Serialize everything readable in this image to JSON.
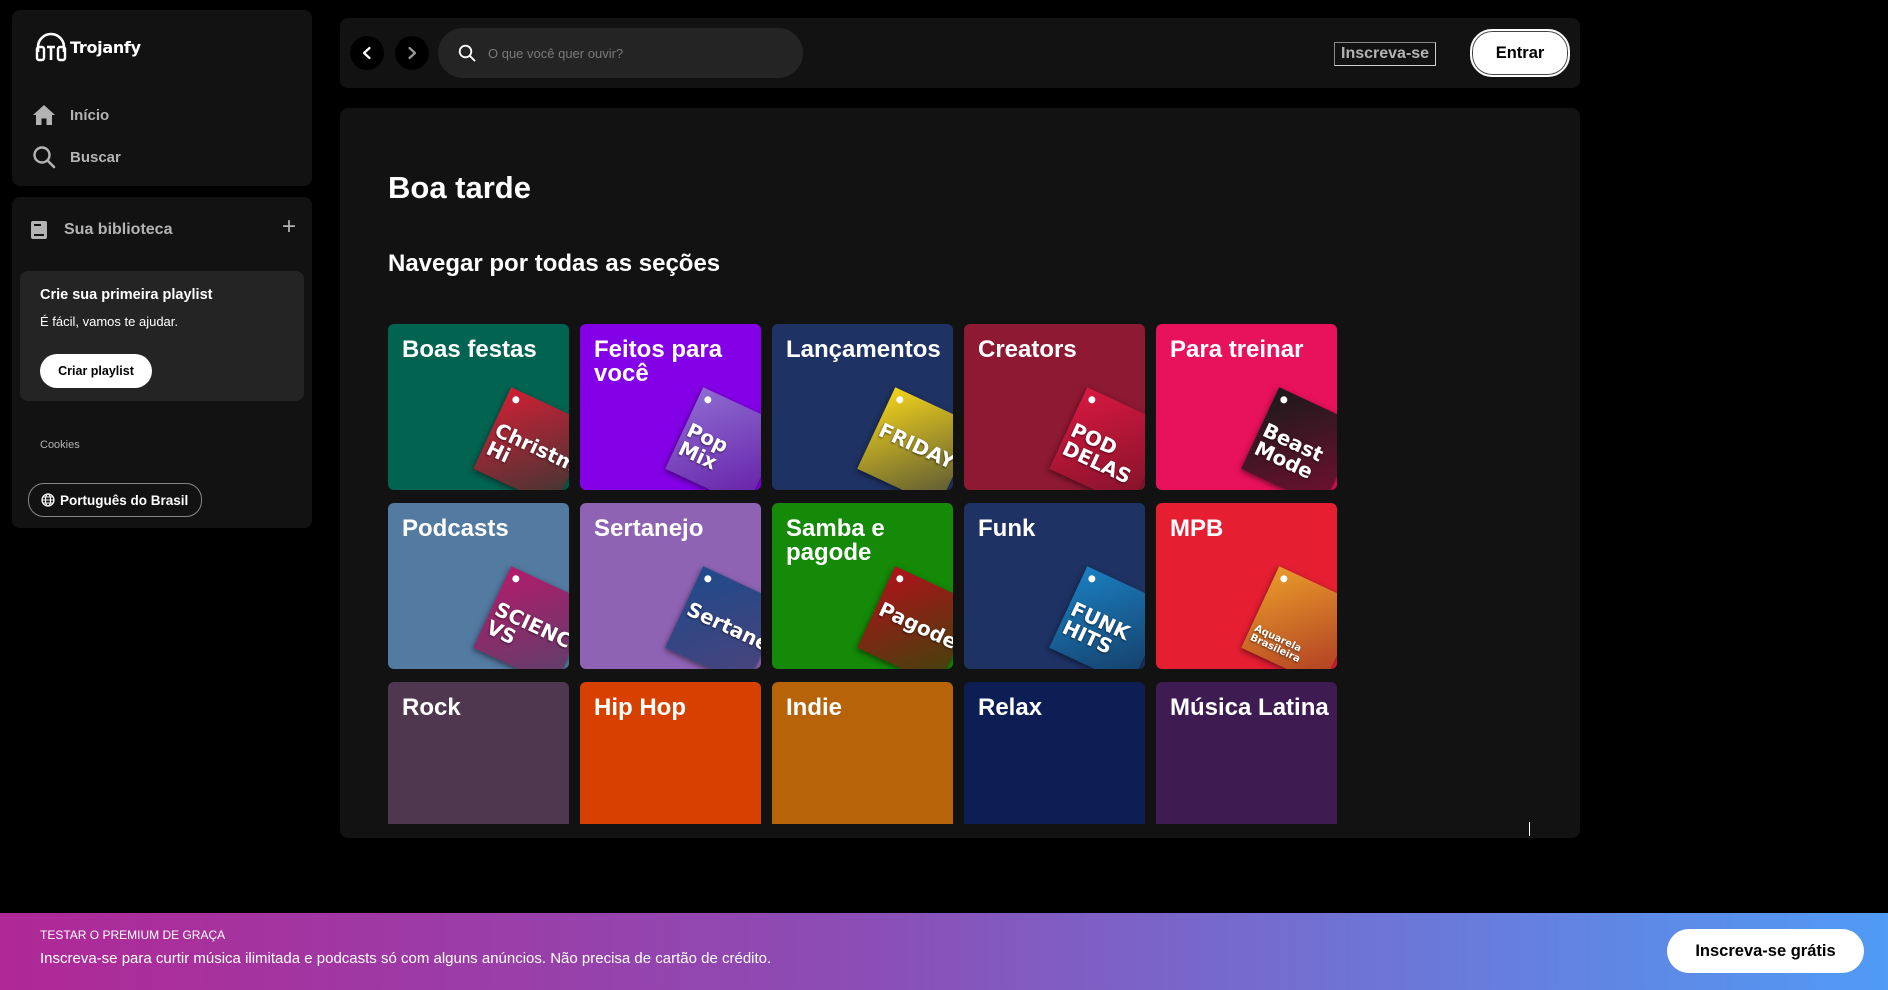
{
  "brand": {
    "name": "Trojanfy"
  },
  "nav": {
    "home": "Início",
    "search": "Buscar"
  },
  "library": {
    "title": "Sua biblioteca",
    "add_symbol": "+",
    "create_card": {
      "title": "Crie sua primeira playlist",
      "subtitle": "É fácil, vamos te ajudar.",
      "button": "Criar playlist"
    },
    "cookies": "Cookies",
    "language": "Português do Brasil"
  },
  "header": {
    "search_placeholder": "O que você quer ouvir?",
    "signup": "Inscreva-se",
    "login": "Entrar"
  },
  "main": {
    "greeting": "Boa tarde",
    "section_title": "Navegar por todas as seções",
    "categories": [
      {
        "title": "Boas festas",
        "color": "#006450",
        "art_color": "#d01f35",
        "art_text": "Christm Hi"
      },
      {
        "title": "Feitos para você",
        "color": "#8400e7",
        "art_color": "#8d6bd1",
        "art_text": "Pop Mix"
      },
      {
        "title": "Lançamentos",
        "color": "#1e3264",
        "art_color": "#f2d21b",
        "art_text": "FRIDAY"
      },
      {
        "title": "Creators",
        "color": "#8d1932",
        "art_color": "#d81840",
        "art_text": "POD DELAS"
      },
      {
        "title": "Para treinar",
        "color": "#e8115b",
        "art_color": "#1a1a1a",
        "art_text": "Beast Mode"
      },
      {
        "title": "Podcasts",
        "color": "#537aa1",
        "art_color": "#b31b6b",
        "art_text": "SCIENCE VS"
      },
      {
        "title": "Sertanejo",
        "color": "#8f63b4",
        "art_color": "#1f4a8a",
        "art_text": "Sertanejo"
      },
      {
        "title": "Samba e pagode",
        "color": "#148a08",
        "art_color": "#b0121a",
        "art_text": "Pagodeira"
      },
      {
        "title": "Funk",
        "color": "#1e3264",
        "art_color": "#1a7fc0",
        "art_text": "FUNK HITS"
      },
      {
        "title": "MPB",
        "color": "#e61e32",
        "art_color": "#e89a2a",
        "art_text": "Aquarela Brasileira"
      },
      {
        "title": "Rock",
        "color": "#503750",
        "art_color": "#503750",
        "art_text": ""
      },
      {
        "title": "Hip Hop",
        "color": "#d84000",
        "art_color": "#d84000",
        "art_text": ""
      },
      {
        "title": "Indie",
        "color": "#b6630a",
        "art_color": "#b6630a",
        "art_text": ""
      },
      {
        "title": "Relax",
        "color": "#0d1e54",
        "art_color": "#0d1e54",
        "art_text": ""
      },
      {
        "title": "Música Latina",
        "color": "#3e1c52",
        "art_color": "#3e1c52",
        "art_text": ""
      }
    ]
  },
  "banner": {
    "title": "TESTAR O PREMIUM DE GRAÇA",
    "text": "Inscreva-se para curtir música ilimitada e podcasts só com alguns anúncios. Não precisa de cartão de crédito.",
    "button": "Inscreva-se grátis"
  }
}
